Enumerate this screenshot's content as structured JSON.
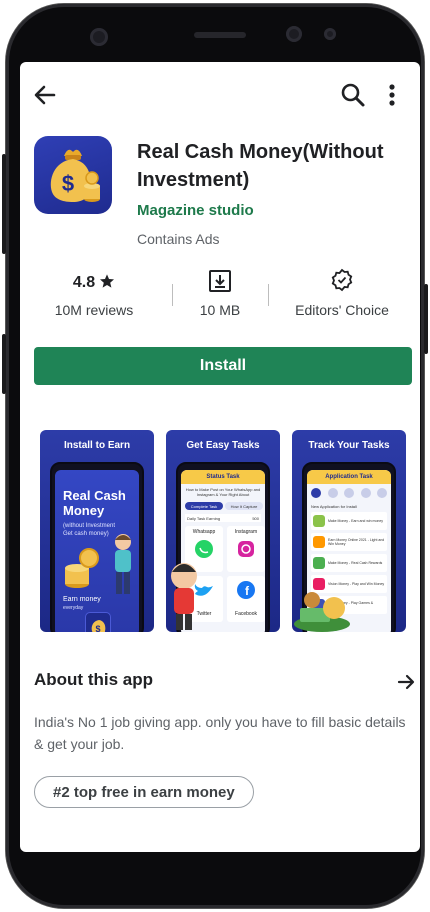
{
  "app": {
    "title": "Real Cash Money(Without Investment)",
    "developer": "Magazine studio",
    "contains_ads": "Contains Ads",
    "icon": "money-bag-dollar-icon"
  },
  "stats": {
    "rating": "4.8",
    "rating_icon": "star-icon",
    "reviews": "10M reviews",
    "size_icon": "download-icon",
    "size": "10 MB",
    "badge_icon": "editors-choice-icon",
    "badge": "Editors' Choice"
  },
  "install": {
    "label": "Install",
    "color": "#1f8456"
  },
  "screenshots": [
    {
      "title": "Install to Earn",
      "headline_line1": "Real Cash",
      "headline_line2": "Money",
      "sub_line1": "(without Investment",
      "sub_line2": "Get cash money)",
      "footer_line1": "Earn money",
      "footer_line2": "everyday"
    },
    {
      "title": "Get Easy Tasks",
      "header": "Status Task",
      "intro": "How to Make Post on Your WhatsApp and Instagram & Your Right About",
      "tab1": "Complete Task",
      "tab2": "How It Capture",
      "row": "Daily Task Earning",
      "row_value": "500",
      "cards": [
        "Whatsapp",
        "Instagram",
        "Twitter",
        "Facebook"
      ]
    },
    {
      "title": "Track Your Tasks",
      "header": "Application Task",
      "section": "New Application for Install",
      "items": [
        "Make Money - Earn and win money",
        "Earn Money Online 2021 - Light and Win Money",
        "Make Money - Real Cash Rewards",
        "Vision Money - Play and Win Money",
        "Cash Money - Play Games & Rewards"
      ]
    }
  ],
  "about": {
    "title": "About this app",
    "arrow_icon": "arrow-right-icon",
    "description": "India's No 1 job giving app. only you have to fill basic details & get your job."
  },
  "chip": {
    "label": "#2 top free in earn money"
  },
  "nav": {
    "back_icon": "back-arrow-icon",
    "search_icon": "search-icon",
    "menu_icon": "more-vert-icon"
  },
  "colors": {
    "accent_green": "#1f8456",
    "developer_green": "#1e7a4b",
    "promo_blue": "#2d3ca8",
    "mini_yellow": "#f7c948"
  }
}
